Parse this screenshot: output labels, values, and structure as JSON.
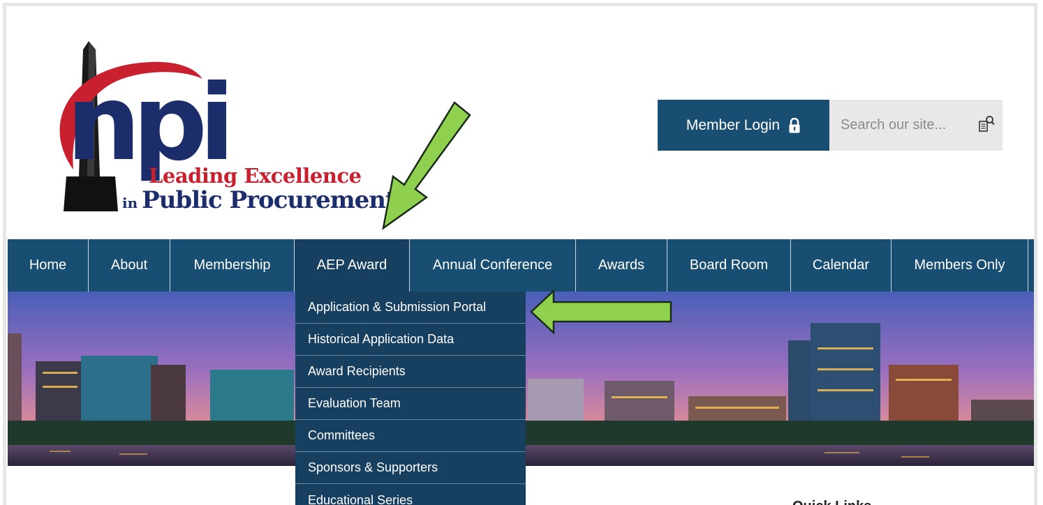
{
  "logo": {
    "mark": "npi",
    "tagline_line1": "Leading Excellence",
    "tagline_small": "in",
    "tagline_line2": "Public Procurement"
  },
  "header": {
    "login_label": "Member Login",
    "search_placeholder": "Search our site..."
  },
  "nav": {
    "items": [
      {
        "label": "Home"
      },
      {
        "label": "About"
      },
      {
        "label": "Membership"
      },
      {
        "label": "AEP Award"
      },
      {
        "label": "Annual Conference"
      },
      {
        "label": "Awards"
      },
      {
        "label": "Board Room"
      },
      {
        "label": "Calendar"
      },
      {
        "label": "Members Only"
      }
    ],
    "active_index": 3
  },
  "dropdown": {
    "items": [
      {
        "label": "Application & Submission Portal"
      },
      {
        "label": "Historical Application Data"
      },
      {
        "label": "Award Recipients"
      },
      {
        "label": "Evaluation Team"
      },
      {
        "label": "Committees"
      },
      {
        "label": "Sponsors & Supporters"
      },
      {
        "label": "Educational Series"
      }
    ]
  },
  "sidebar": {
    "quick_links_title": "Quick Links"
  },
  "colors": {
    "nav_bg": "#184e72",
    "nav_active": "#173f60",
    "logo_red": "#c8202f",
    "logo_blue": "#1b2d6b",
    "arrow_green": "#8fd14f"
  },
  "icons": {
    "login": "lock-icon",
    "search": "search-icon"
  }
}
